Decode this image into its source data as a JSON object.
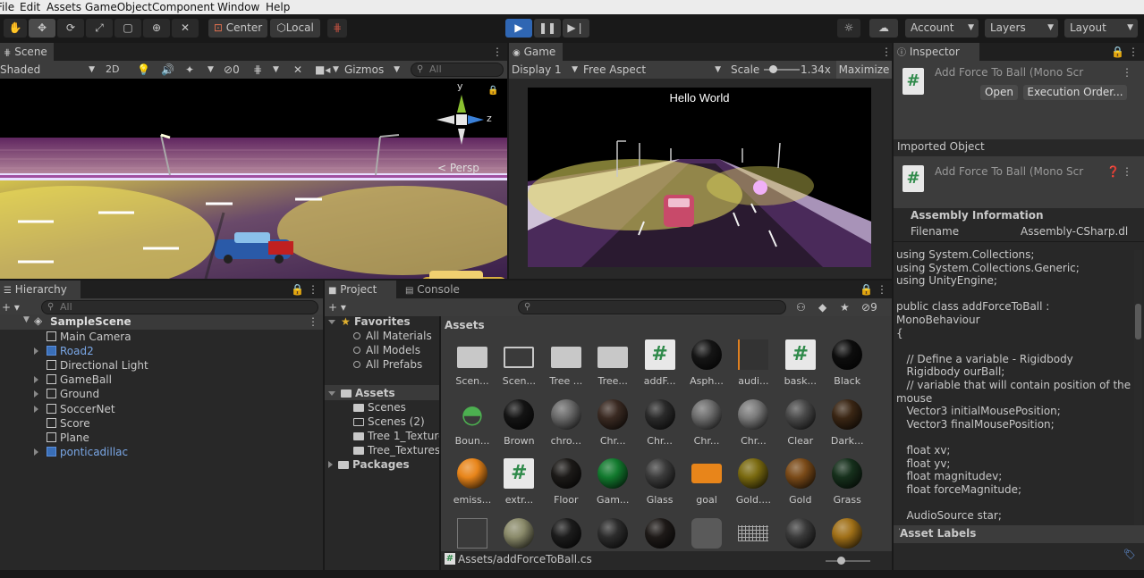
{
  "menu": [
    "File",
    "Edit",
    "Assets",
    "GameObject",
    "Component",
    "Window",
    "Help"
  ],
  "toolbar": {
    "pivot": "Center",
    "space": "Local",
    "account": "Account",
    "layers": "Layers",
    "layout": "Layout"
  },
  "scene": {
    "tab": "Scene",
    "shading": "Shaded",
    "mode2d": "2D",
    "hidden_count": "0",
    "gizmos": "Gizmos",
    "search_placeholder": "All",
    "persp_label": "< Persp",
    "axis_y": "y",
    "axis_z": "z"
  },
  "game": {
    "tab": "Game",
    "display": "Display 1",
    "aspect": "Free Aspect",
    "scale_label": "Scale",
    "scale_value": "1.34x",
    "maximize": "Maximize",
    "overlay_text": "Hello World"
  },
  "inspector": {
    "tab": "Inspector",
    "title": "Add Force To Ball (Mono Scr",
    "open_button": "Open",
    "execution_order_button": "Execution Order...",
    "imported_object": "Imported Object",
    "imported_title": "Add Force To Ball (Mono Scr",
    "assembly_info": "Assembly Information",
    "filename_label": "Filename",
    "filename_value": "Assembly-CSharp.dl",
    "code": "using System.Collections;\nusing System.Collections.Generic;\nusing UnityEngine;\n\npublic class addForceToBall :\nMonoBehaviour\n{\n\n   // Define a variable - Rigidbody\n   Rigidbody ourBall;\n   // variable that will contain position of the\nmouse\n   Vector3 initialMousePosition;\n   Vector3 finalMousePosition;\n\n   float xv;\n   float yv;\n   float magnitudev;\n   float forceMagnitude;\n\n   AudioSource star;",
    "asset_labels": "Asset Labels"
  },
  "hierarchy": {
    "tab": "Hierarchy",
    "search_placeholder": "All",
    "scene": "SampleScene",
    "items": [
      {
        "label": "Main Camera",
        "expandable": false,
        "prefab": false
      },
      {
        "label": "Road2",
        "expandable": true,
        "prefab": true
      },
      {
        "label": "Directional Light",
        "expandable": false,
        "prefab": false
      },
      {
        "label": "GameBall",
        "expandable": true,
        "prefab": false
      },
      {
        "label": "Ground",
        "expandable": true,
        "prefab": false
      },
      {
        "label": "SoccerNet",
        "expandable": true,
        "prefab": false
      },
      {
        "label": "Score",
        "expandable": false,
        "prefab": false
      },
      {
        "label": "Plane",
        "expandable": false,
        "prefab": false
      },
      {
        "label": "ponticadillac",
        "expandable": true,
        "prefab": true
      }
    ]
  },
  "project": {
    "tab": "Project",
    "console_tab": "Console",
    "hidden_count": "9",
    "favorites": "Favorites",
    "fav_items": [
      "All Materials",
      "All Models",
      "All Prefabs"
    ],
    "assets_root": "Assets",
    "asset_folders": [
      "Scenes",
      "Scenes (2)",
      "Tree 1_Textures",
      "Tree_Textures"
    ],
    "packages": "Packages",
    "grid_title": "Assets",
    "footer_path": "Assets/addForceToBall.cs",
    "grid": [
      {
        "label": "Scen...",
        "kind": "folder",
        "color": "#c8c8c8"
      },
      {
        "label": "Scen...",
        "kind": "folder-outline",
        "color": "#c8c8c8"
      },
      {
        "label": "Tree ...",
        "kind": "folder",
        "color": "#c8c8c8"
      },
      {
        "label": "Tree...",
        "kind": "folder",
        "color": "#c8c8c8"
      },
      {
        "label": "addF...",
        "kind": "script",
        "color": "#e8e8e8"
      },
      {
        "label": "Asph...",
        "kind": "sphere",
        "color": "#151515"
      },
      {
        "label": "audi...",
        "kind": "audio",
        "color": "#333333"
      },
      {
        "label": "bask...",
        "kind": "script",
        "color": "#e8e8e8"
      },
      {
        "label": "Black",
        "kind": "sphere",
        "color": "#0d0d0d"
      },
      {
        "label": "Boun...",
        "kind": "physic",
        "color": "#4caf50"
      },
      {
        "label": "Brown",
        "kind": "sphere",
        "color": "#141414"
      },
      {
        "label": "chro...",
        "kind": "sphere",
        "color": "#6a6a6a"
      },
      {
        "label": "Chr...",
        "kind": "sphere",
        "color": "#3a2a22"
      },
      {
        "label": "Chr...",
        "kind": "sphere",
        "color": "#2a2a2a"
      },
      {
        "label": "Chr...",
        "kind": "sphere",
        "color": "#6e6e6e"
      },
      {
        "label": "Chr...",
        "kind": "sphere",
        "color": "#7a7a7a"
      },
      {
        "label": "Clear",
        "kind": "sphere",
        "color": "#4a4a4a"
      },
      {
        "label": "Dark...",
        "kind": "sphere",
        "color": "#3a2614"
      },
      {
        "label": "emiss...",
        "kind": "sphere",
        "color": "#e8851a"
      },
      {
        "label": "extr...",
        "kind": "script",
        "color": "#e8e8e8"
      },
      {
        "label": "Floor",
        "kind": "sphere",
        "color": "#1c1a18"
      },
      {
        "label": "Gam...",
        "kind": "sphere",
        "color": "#127a2e"
      },
      {
        "label": "Glass",
        "kind": "sphere",
        "color": "#3c3c3c"
      },
      {
        "label": "goal",
        "kind": "goal",
        "color": "#e8851a"
      },
      {
        "label": "Gold....",
        "kind": "sphere",
        "color": "#7a6a10"
      },
      {
        "label": "Gold",
        "kind": "sphere",
        "color": "#7a4a18"
      },
      {
        "label": "Grass",
        "kind": "sphere",
        "color": "#16301c"
      },
      {
        "label": "",
        "kind": "door",
        "color": "#3a3a3a"
      },
      {
        "label": "",
        "kind": "sphere",
        "color": "#8a8a6a"
      },
      {
        "label": "",
        "kind": "sphere",
        "color": "#1c1c1c"
      },
      {
        "label": "",
        "kind": "sphere",
        "color": "#2c2c2c"
      },
      {
        "label": "",
        "kind": "sphere",
        "color": "#1e1a18"
      },
      {
        "label": "",
        "kind": "barrel",
        "color": "#5a5a5a"
      },
      {
        "label": "",
        "kind": "grid",
        "color": "#aaaaaa"
      },
      {
        "label": "",
        "kind": "sphere",
        "color": "#3a3a3a"
      },
      {
        "label": "",
        "kind": "sphere",
        "color": "#a07018"
      }
    ]
  },
  "colors": {
    "play_blue": "#2f66b3",
    "prefab_blue": "#7aa7e6",
    "script_green": "#2f8a4a"
  }
}
